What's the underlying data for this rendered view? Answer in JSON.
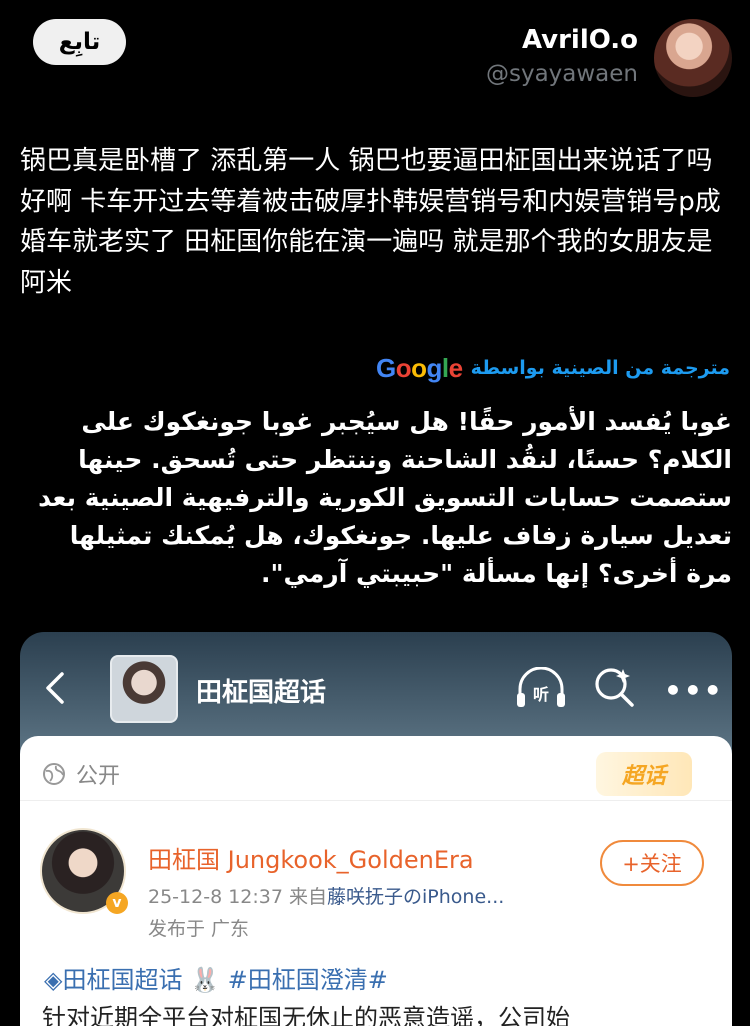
{
  "header": {
    "follow_label": "تابِع",
    "display_name": "AvrilO.o",
    "handle": "@syayawaen"
  },
  "post": {
    "text": "锅巴真是卧槽了 添乱第一人 锅巴也要逼田柾国出来说话了吗 好啊 卡车开过去等着被击破厚扑韩娱营销号和内娱营销号p成婚车就老实了 田柾国你能在演一遍吗 就是那个我的女朋友是阿米",
    "translate_label": "مترجمة من الصينية بواسطة",
    "translate_provider": "Google",
    "translated_text": "غوبا يُفسد الأمور حقًا! هل سيُجبر غوبا جونغكوك على الكلام؟ حسنًا، لنقُد الشاحنة وننتظر حتى تُسحق. حينها ستصمت حسابات التسويق الكورية والترفيهية الصينية بعد تعديل سيارة زفاف عليها. جونغكوك، هل يُمكنك تمثيلها مرة أخرى؟ إنها مسألة \"حبيبتي آرمي\"."
  },
  "embed": {
    "topic_title": "田柾国超话",
    "public_label": "公开",
    "badge_label": "超话",
    "poster_name": "田柾国 Jungkook_GoldenEra",
    "poster_time": "25-12-8 12:37",
    "poster_from": "来自",
    "poster_source": "藤咲抚子のiPhone...",
    "poster_location": "发布于 广东",
    "follow_user_label": "+关注",
    "hashtags": "◈田柾国超话 🐰 #田柾国澄清#",
    "preview_text": "针对近期全平台对柾国无休止的恶意造谣，公司始"
  },
  "colors": {
    "background": "#000000",
    "link_blue": "#1d9bf0",
    "handle_gray": "#71767b",
    "weibo_orange": "#e8632b"
  },
  "icons": [
    "back-icon",
    "listen-icon",
    "search-icon",
    "more-icon",
    "globe-icon",
    "verified-badge-icon"
  ]
}
